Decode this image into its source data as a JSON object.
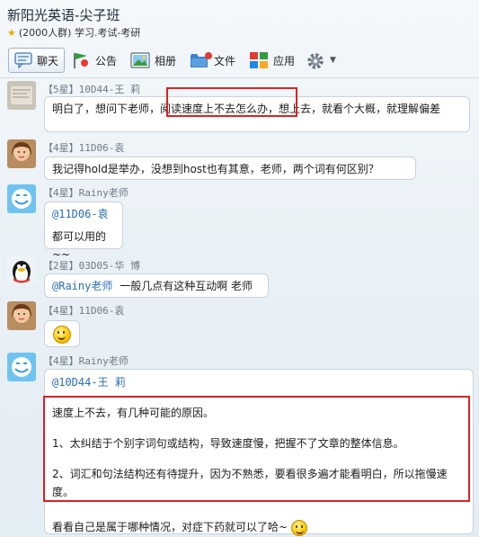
{
  "window": {
    "title": "新阳光英语-尖子班",
    "subtitle": "(2000人群) 学习.考试-考研"
  },
  "toolbar": {
    "chat": "聊天",
    "notice": "公告",
    "album": "相册",
    "files": "文件",
    "apps": "应用"
  },
  "messages": [
    {
      "sender": "【5星】10D44-王 莉",
      "text": "明白了，想问下老师，阅读速度上不去怎么办，想上去，就看个大概，就理解偏差",
      "highlight": "阅读速度上不去怎么办"
    },
    {
      "sender": "【4星】11D06-袁",
      "text": "我记得hold是举办，没想到host也有其意，老师，两个词有何区别？"
    },
    {
      "sender": "【4星】Rainy老师",
      "mention": "@11D06-袁",
      "text": "都可以用的~~"
    },
    {
      "sender": "【2星】03D05-华 博",
      "mention": "@Rainy老师",
      "text": "一般几点有这种互动啊 老师"
    },
    {
      "sender": "【4星】11D06-袁"
    },
    {
      "sender": "【4星】Rainy老师",
      "mention": "@10D44-王 莉",
      "paragraphs": [
        "速度上不去，有几种可能的原因。",
        "1、太纠结于个别字词句或结构，导致速度慢，把握不了文章的整体信息。",
        "2、词汇和句法结构还有待提升，因为不熟悉，要看很多遍才能看明白，所以拖慢速度。"
      ],
      "closing": "看看自己是属于哪种情况，对症下药就可以了哈~"
    }
  ]
}
